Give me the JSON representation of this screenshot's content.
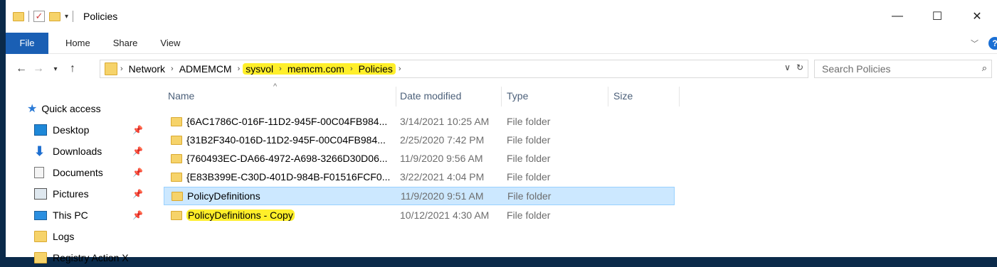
{
  "window": {
    "title": "Policies"
  },
  "ribbon": {
    "file": "File",
    "tabs": [
      "Home",
      "Share",
      "View"
    ]
  },
  "address": {
    "crumbs": [
      "Network",
      "ADMEMCM",
      "sysvol",
      "memcm.com",
      "Policies"
    ]
  },
  "search": {
    "placeholder": "Search Policies"
  },
  "navpane": {
    "quick_access": "Quick access",
    "items": [
      "Desktop",
      "Downloads",
      "Documents",
      "Pictures",
      "This PC",
      "Logs",
      "Registry Action X"
    ]
  },
  "columns": {
    "name": "Name",
    "date": "Date modified",
    "type": "Type",
    "size": "Size"
  },
  "files": [
    {
      "name": "{6AC1786C-016F-11D2-945F-00C04FB984...",
      "date": "3/14/2021 10:25 AM",
      "type": "File folder"
    },
    {
      "name": "{31B2F340-016D-11D2-945F-00C04FB984...",
      "date": "2/25/2020 7:42 PM",
      "type": "File folder"
    },
    {
      "name": "{760493EC-DA66-4972-A698-3266D30D06...",
      "date": "11/9/2020 9:56 AM",
      "type": "File folder"
    },
    {
      "name": "{E83B399E-C30D-401D-984B-F01516FCF0...",
      "date": "3/22/2021 4:04 PM",
      "type": "File folder"
    },
    {
      "name": "PolicyDefinitions",
      "date": "11/9/2020 9:51 AM",
      "type": "File folder"
    },
    {
      "name": "PolicyDefinitions - Copy",
      "date": "10/12/2021 4:30 AM",
      "type": "File folder"
    }
  ],
  "colors": {
    "accent": "#1a5fb4",
    "highlight": "#ffef2a",
    "selection": "#cce8ff"
  }
}
